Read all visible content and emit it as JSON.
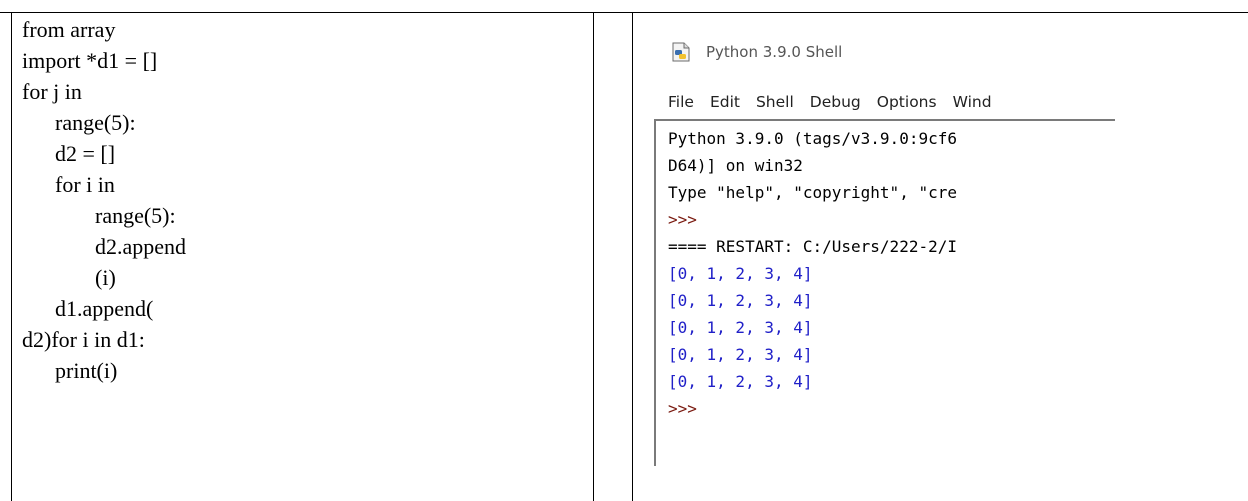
{
  "code": {
    "lines": [
      "from array",
      "import *d1 = []",
      "for j in",
      "range(5):",
      "d2 = []",
      "for i in",
      "range(5):",
      "d2.append",
      "(i)",
      "d1.append(",
      "d2)for i in d1:",
      "print(i)"
    ]
  },
  "shell": {
    "title": "Python 3.9.0 Shell",
    "icon": "python-idle-icon",
    "menu": [
      "File",
      "Edit",
      "Shell",
      "Debug",
      "Options",
      "Wind"
    ],
    "banner1": "Python 3.9.0 (tags/v3.9.0:9cf6",
    "banner2": "D64)] on win32",
    "banner3": "Type \"help\", \"copyright\", \"cre",
    "prompt1": ">>>",
    "restart": "==== RESTART: C:/Users/222-2/I",
    "outputs": [
      "[0, 1, 2, 3, 4]",
      "[0, 1, 2, 3, 4]",
      "[0, 1, 2, 3, 4]",
      "[0, 1, 2, 3, 4]",
      "[0, 1, 2, 3, 4]"
    ],
    "prompt2": ">>>",
    "colors": {
      "output": "#2020c8",
      "prompt": "#7a1a10"
    }
  }
}
